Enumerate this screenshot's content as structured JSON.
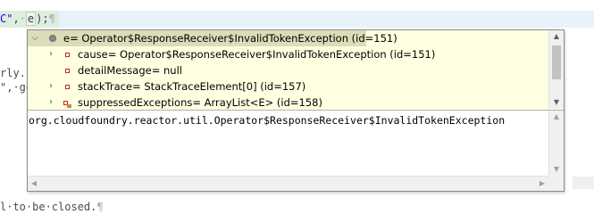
{
  "editor": {
    "fragment_top_str": "C\"",
    "fragment_top_sep": ",",
    "fragment_top_ws": "·",
    "fragment_top_var": "e",
    "fragment_top_end": ");",
    "fragment_top_pil": "¶",
    "fragment_mid1": "rly.",
    "fragment_mid1_dots": ".",
    "fragment_mid2": "\",·ge",
    "fragment_bottom": "l·to·be·closed.",
    "fragment_bottom_pil": "¶"
  },
  "popup": {
    "tree": [
      {
        "expander": "expanded",
        "icon": "root-variable-icon",
        "label": "e= Operator$ResponseReceiver$InvalidTokenException  (id=151)",
        "selected": true
      },
      {
        "expander": "collapsed",
        "icon": "field-icon",
        "label": "cause= Operator$ResponseReceiver$InvalidTokenException  (id=151)",
        "selected": false
      },
      {
        "expander": "none",
        "icon": "field-icon",
        "label": "detailMessage= null",
        "selected": false
      },
      {
        "expander": "collapsed",
        "icon": "field-icon",
        "label": "stackTrace= StackTraceElement[0]  (id=157)",
        "selected": false
      },
      {
        "expander": "collapsed",
        "icon": "field-set-icon",
        "label": "suppressedExceptions= ArrayList<E>  (id=158)",
        "selected": false
      }
    ],
    "detail_text": "org.cloudfoundry.reactor.util.Operator$ResponseReceiver$InvalidTokenException"
  },
  "colors": {
    "popup_background": "#ffffe1",
    "selection": "#dcdcb8",
    "field_icon": "#cc2233",
    "string_literal": "#2a00ff"
  }
}
